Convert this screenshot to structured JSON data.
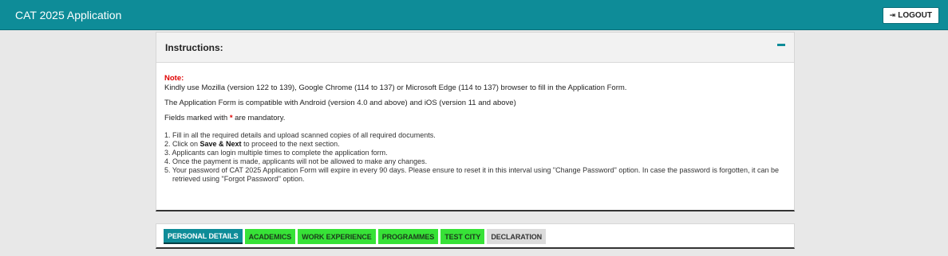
{
  "header": {
    "title": "CAT 2025 Application",
    "logout_label": "LOGOUT",
    "logout_icon": "⇥"
  },
  "instructions": {
    "title": "Instructions:",
    "note_label": "Note:",
    "browser_note": "Kindly use Mozilla (version 122 to 139), Google Chrome (114 to 137) or Microsoft Edge (114 to 137) browser to fill in the Application Form.",
    "compat_note": "The Application Form is compatible with Android (version 4.0 and above) and iOS (version 11 and above)",
    "mandatory_prefix": "Fields marked with ",
    "mandatory_star": "*",
    "mandatory_suffix": " are mandatory.",
    "steps": {
      "s1": "1. Fill in all the required details and upload scanned copies of all required documents.",
      "s2_prefix": "2. Click on ",
      "s2_bold": "Save & Next",
      "s2_suffix": " to proceed to the next section.",
      "s3": "3. Applicants can login multiple times to complete the application form.",
      "s4": "4. Once the payment is made, applicants will not be allowed to make any changes.",
      "s5": "5. Your password of CAT 2025 Application Form will expire in every 90 days. Please ensure to reset it in this interval using \"Change Password\" option. In case the password is forgotten, it can be retrieved using \"Forgot Password\" option."
    }
  },
  "tabs": {
    "t1": "PERSONAL DETAILS",
    "t2": "ACADEMICS",
    "t3": "WORK EXPERIENCE",
    "t4": "PROGRAMMES",
    "t5": "TEST CITY",
    "t6": "DECLARATION"
  },
  "colors": {
    "brand": "#0e8c98",
    "completed_tab": "#37e237",
    "pending_tab": "#dcdcdc",
    "required": "#e00000"
  }
}
